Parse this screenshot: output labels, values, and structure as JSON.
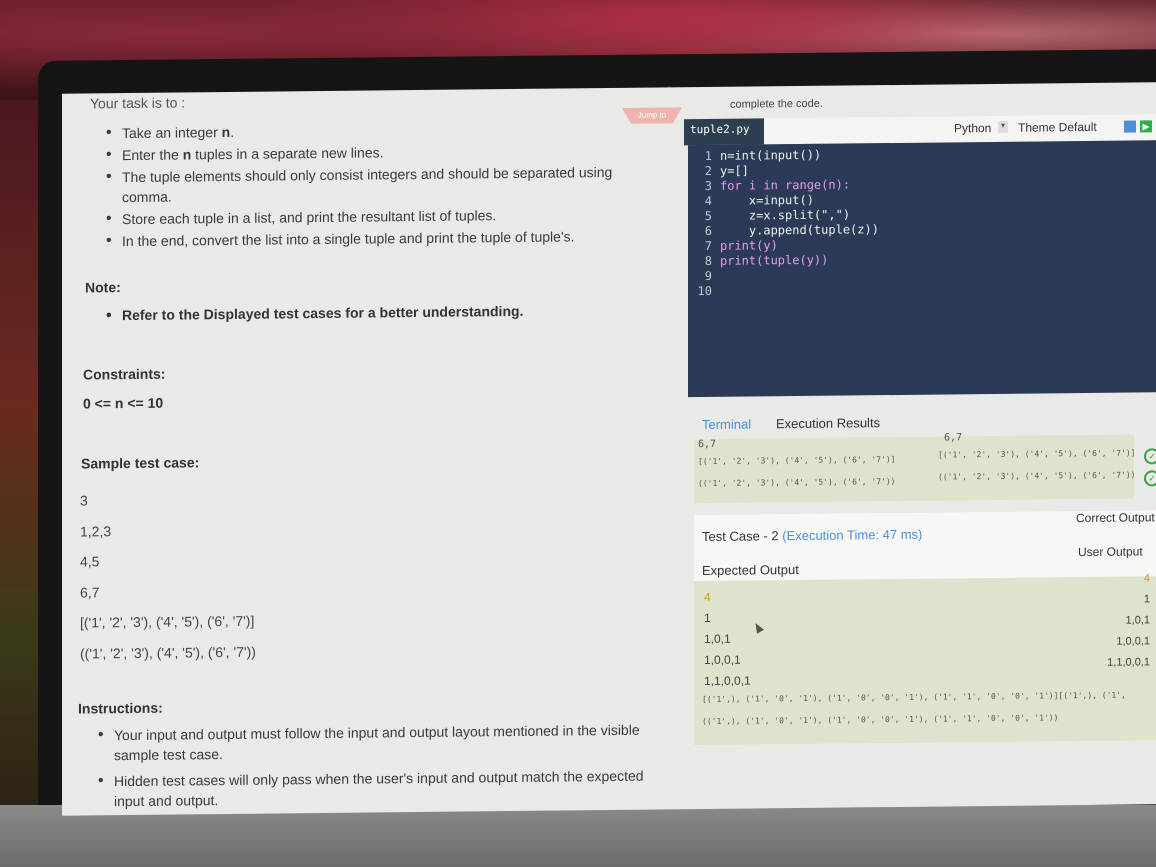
{
  "task": {
    "intro": "Your task is to :",
    "bullets": [
      {
        "pre": "Take an integer ",
        "bold": "n",
        "post": "."
      },
      {
        "pre": "Enter the ",
        "bold": "n",
        "post": " tuples in a separate new lines."
      },
      {
        "pre": "The tuple elements should only consist integers and should be separated using comma.",
        "bold": "",
        "post": ""
      },
      {
        "pre": "Store each tuple in a list, and print the resultant list of tuples.",
        "bold": "",
        "post": ""
      },
      {
        "pre": "In the end, convert the list into a single tuple and print the tuple of tuple's.",
        "bold": "",
        "post": ""
      }
    ],
    "note_heading": "Note:",
    "note_item": "Refer to the Displayed test cases for a better understanding.",
    "constraints_heading": "Constraints:",
    "constraints_value": "0 <= n <= 10",
    "sample_heading": "Sample test case:",
    "sample_lines": [
      "3",
      "1,2,3",
      "4,5",
      "6,7",
      "[('1', '2', '3'), ('4', '5'), ('6', '7')]",
      "(('1', '2', '3'), ('4', '5'), ('6', '7'))"
    ],
    "instructions_heading": "Instructions:",
    "instructions": [
      "Your input and output must follow the input and output layout mentioned in the visible sample test case.",
      "Hidden test cases will only pass when the user's input and output match the expected input and output."
    ]
  },
  "editor": {
    "jump_label": "Jump to",
    "header_text": "complete the code.",
    "filename": "tuple2.py",
    "language": "Python",
    "theme": "Theme Default",
    "lines": [
      {
        "n": "1",
        "code": "n=int(input())"
      },
      {
        "n": "2",
        "code": "y=[]"
      },
      {
        "n": "3",
        "code": "for i in range(n):"
      },
      {
        "n": "4",
        "code": "    x=input()"
      },
      {
        "n": "5",
        "code": "    z=x.split(\",\")"
      },
      {
        "n": "6",
        "code": "    y.append(tuple(z))"
      },
      {
        "n": "7",
        "code": "print(y)"
      },
      {
        "n": "8",
        "code": "print(tuple(y))"
      },
      {
        "n": "9",
        "code": ""
      },
      {
        "n": "10",
        "code": ""
      }
    ]
  },
  "results": {
    "tab_terminal": "Terminal",
    "tab_execution": "Execution Results",
    "tc1": {
      "expected_top": "6,7",
      "expected_list": "[('1', '2', '3'), ('4', '5'), ('6', '7')]",
      "expected_tuple": "(('1', '2', '3'), ('4', '5'), ('6', '7'))",
      "user_top": "6,7",
      "user_list": "[('1', '2', '3'), ('4', '5'), ('6', '7')]",
      "user_tuple": "(('1', '2', '3'), ('4', '5'), ('6', '7'))"
    },
    "tc2": {
      "title": "Test Case - 2",
      "time": "(Execution Time: 47 ms)",
      "correct_output": "Correct Output",
      "user_output": "User Output",
      "expected_heading": "Expected Output",
      "expected_lines": [
        "4",
        "1",
        "1,0,1",
        "1,0,0,1",
        "1,1,0,0,1"
      ],
      "user_lines": [
        "4",
        "1",
        "1,0,1",
        "1,0,0,1",
        "1,1,0,0,1"
      ],
      "list_line": "[('1',), ('1', '0', '1'), ('1', '0', '0', '1'), ('1', '1', '0', '0', '1')]",
      "tuple_line": "(('1',), ('1', '0', '1'), ('1', '0', '0', '1'), ('1', '1', '0', '0', '1'))",
      "user_combined_tail": "[('1',), ('1',"
    }
  },
  "colors": {
    "accent": "#4a8fd8",
    "editor_bg": "#2b3a56",
    "pass": "#3aa04a"
  }
}
